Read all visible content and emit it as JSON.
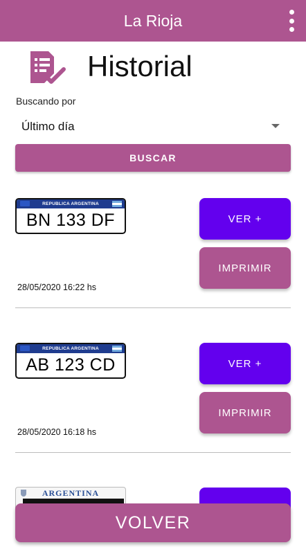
{
  "appbar": {
    "title": "La Rioja",
    "menu_icon": "more-vert-icon"
  },
  "header": {
    "icon": "checklist-document-icon",
    "title": "Historial"
  },
  "search": {
    "label": "Buscando por",
    "selected": "Último día",
    "button_label": "BUSCAR"
  },
  "entries": [
    {
      "plate_band": "REPUBLICA ARGENTINA",
      "plate": "BN 133 DF",
      "date": "28/05/2020 16:22 hs",
      "view_label": "VER +",
      "print_label": "IMPRIMIR"
    },
    {
      "plate_band": "REPUBLICA ARGENTINA",
      "plate": "AB 123 CD",
      "date": "28/05/2020 16:18 hs",
      "view_label": "VER +",
      "print_label": "IMPRIMIR"
    }
  ],
  "partial_entry": {
    "plate_label": "ARGENTINA"
  },
  "footer": {
    "back_label": "VOLVER"
  },
  "colors": {
    "primary": "#ad5590",
    "accent": "#6300ee",
    "plate_band": "#1f3c8f"
  }
}
